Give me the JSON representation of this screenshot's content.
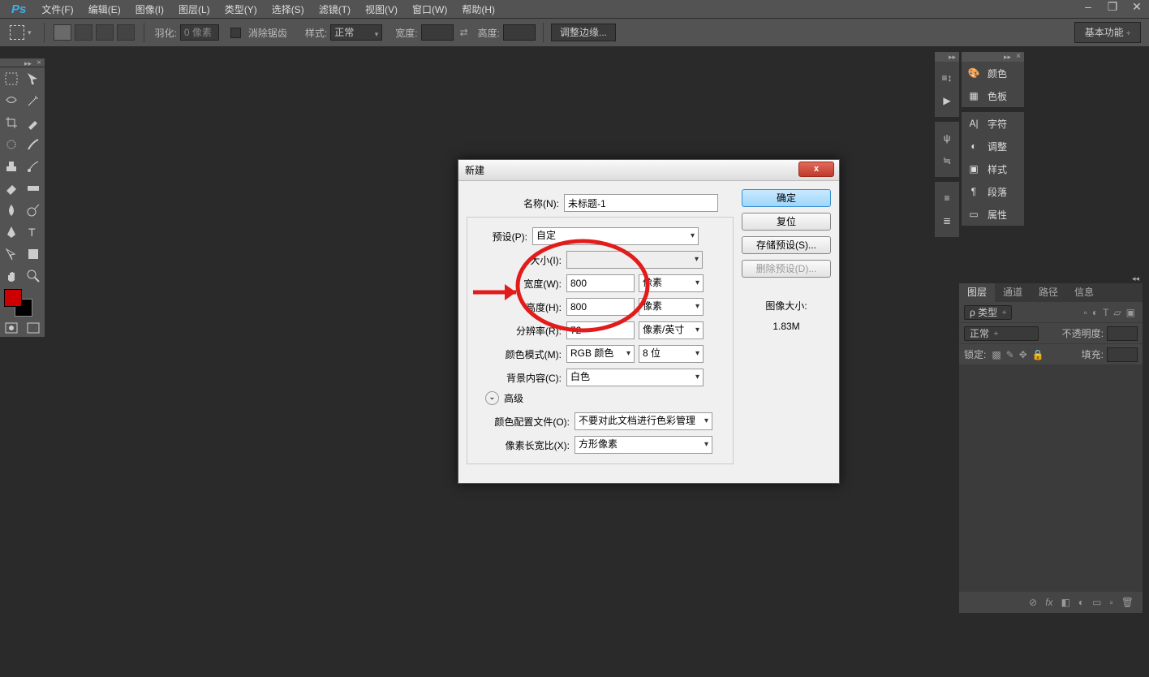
{
  "menu": {
    "items": [
      "文件(F)",
      "编辑(E)",
      "图像(I)",
      "图层(L)",
      "类型(Y)",
      "选择(S)",
      "滤镜(T)",
      "视图(V)",
      "窗口(W)",
      "帮助(H)"
    ]
  },
  "optbar": {
    "feather_label": "羽化:",
    "feather_value": "0 像素",
    "antialias": "消除锯齿",
    "style_label": "样式:",
    "style_value": "正常",
    "width_label": "宽度:",
    "height_label": "高度:",
    "refine": "调整边缘...",
    "workspace": "基本功能"
  },
  "right_panel": {
    "items": [
      "颜色",
      "色板",
      "字符",
      "调整",
      "样式",
      "段落",
      "属性"
    ]
  },
  "layers_panel": {
    "tabs": [
      "图层",
      "通道",
      "路径",
      "信息"
    ],
    "kind_filter": "ρ 类型",
    "blend": "正常",
    "opacity_label": "不透明度:",
    "lock_label": "锁定:",
    "fill_label": "填充:"
  },
  "dialog": {
    "title": "新建",
    "name_label": "名称(N):",
    "name_value": "未标题-1",
    "preset_label": "预设(P):",
    "preset_value": "自定",
    "size_label": "大小(I):",
    "width_label": "宽度(W):",
    "width_value": "800",
    "width_unit": "像素",
    "height_label": "高度(H):",
    "height_value": "800",
    "height_unit": "像素",
    "res_label": "分辨率(R):",
    "res_value": "72",
    "res_unit": "像素/英寸",
    "mode_label": "颜色模式(M):",
    "mode_value": "RGB 颜色",
    "mode_depth": "8 位",
    "bg_label": "背景内容(C):",
    "bg_value": "白色",
    "advanced": "高级",
    "profile_label": "颜色配置文件(O):",
    "profile_value": "不要对此文档进行色彩管理",
    "par_label": "像素长宽比(X):",
    "par_value": "方形像素",
    "ok": "确定",
    "cancel": "复位",
    "save_preset": "存储预设(S)...",
    "delete_preset": "删除预设(D)...",
    "image_size_label": "图像大小:",
    "image_size": "1.83M",
    "close": "x"
  }
}
